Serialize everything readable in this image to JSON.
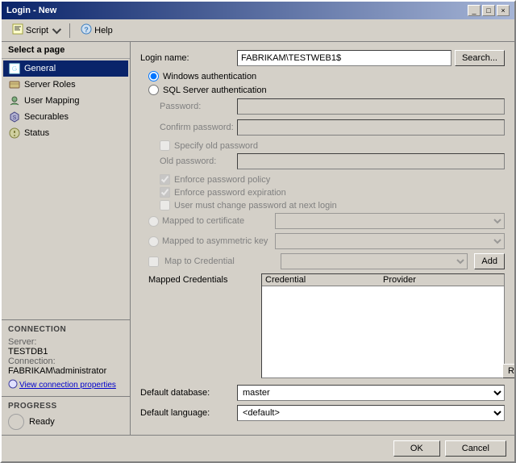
{
  "window": {
    "title": "Login - New",
    "title_buttons": [
      "_",
      "□",
      "×"
    ]
  },
  "toolbar": {
    "script_label": "Script",
    "help_label": "Help"
  },
  "left_panel": {
    "select_page_header": "Select a page",
    "nav_items": [
      {
        "id": "general",
        "label": "General",
        "active": true
      },
      {
        "id": "server-roles",
        "label": "Server Roles",
        "active": false
      },
      {
        "id": "user-mapping",
        "label": "User Mapping",
        "active": false
      },
      {
        "id": "securables",
        "label": "Securables",
        "active": false
      },
      {
        "id": "status",
        "label": "Status",
        "active": false
      }
    ],
    "connection": {
      "header": "Connection",
      "server_label": "Server:",
      "server_value": "TESTDB1",
      "connection_label": "Connection:",
      "connection_value": "FABRIKAM\\administrator",
      "view_link": "View connection properties"
    },
    "progress": {
      "header": "Progress",
      "status": "Ready"
    }
  },
  "form": {
    "login_name_label": "Login name:",
    "login_name_value": "FABRIKAM\\TESTWEB1$",
    "search_btn": "Search...",
    "auth_options": [
      {
        "id": "windows",
        "label": "Windows authentication",
        "checked": true
      },
      {
        "id": "sql",
        "label": "SQL Server authentication",
        "checked": false
      }
    ],
    "password_label": "Password:",
    "confirm_password_label": "Confirm password:",
    "specify_old_password_label": "Specify old password",
    "old_password_label": "Old password:",
    "enforce_password_policy_label": "Enforce password policy",
    "enforce_password_expiration_label": "Enforce password expiration",
    "user_must_change_label": "User must change password at next login",
    "mapped_to_certificate_label": "Mapped to certificate",
    "mapped_to_asymmetric_key_label": "Mapped to asymmetric key",
    "map_to_credential_label": "Map to Credential",
    "add_btn": "Add",
    "mapped_credentials_label": "Mapped Credentials",
    "credential_col": "Credential",
    "provider_col": "Provider",
    "remove_btn": "Remove",
    "default_database_label": "Default database:",
    "default_database_value": "master",
    "default_language_label": "Default language:",
    "default_language_value": "<default>"
  },
  "footer": {
    "ok_label": "OK",
    "cancel_label": "Cancel"
  }
}
